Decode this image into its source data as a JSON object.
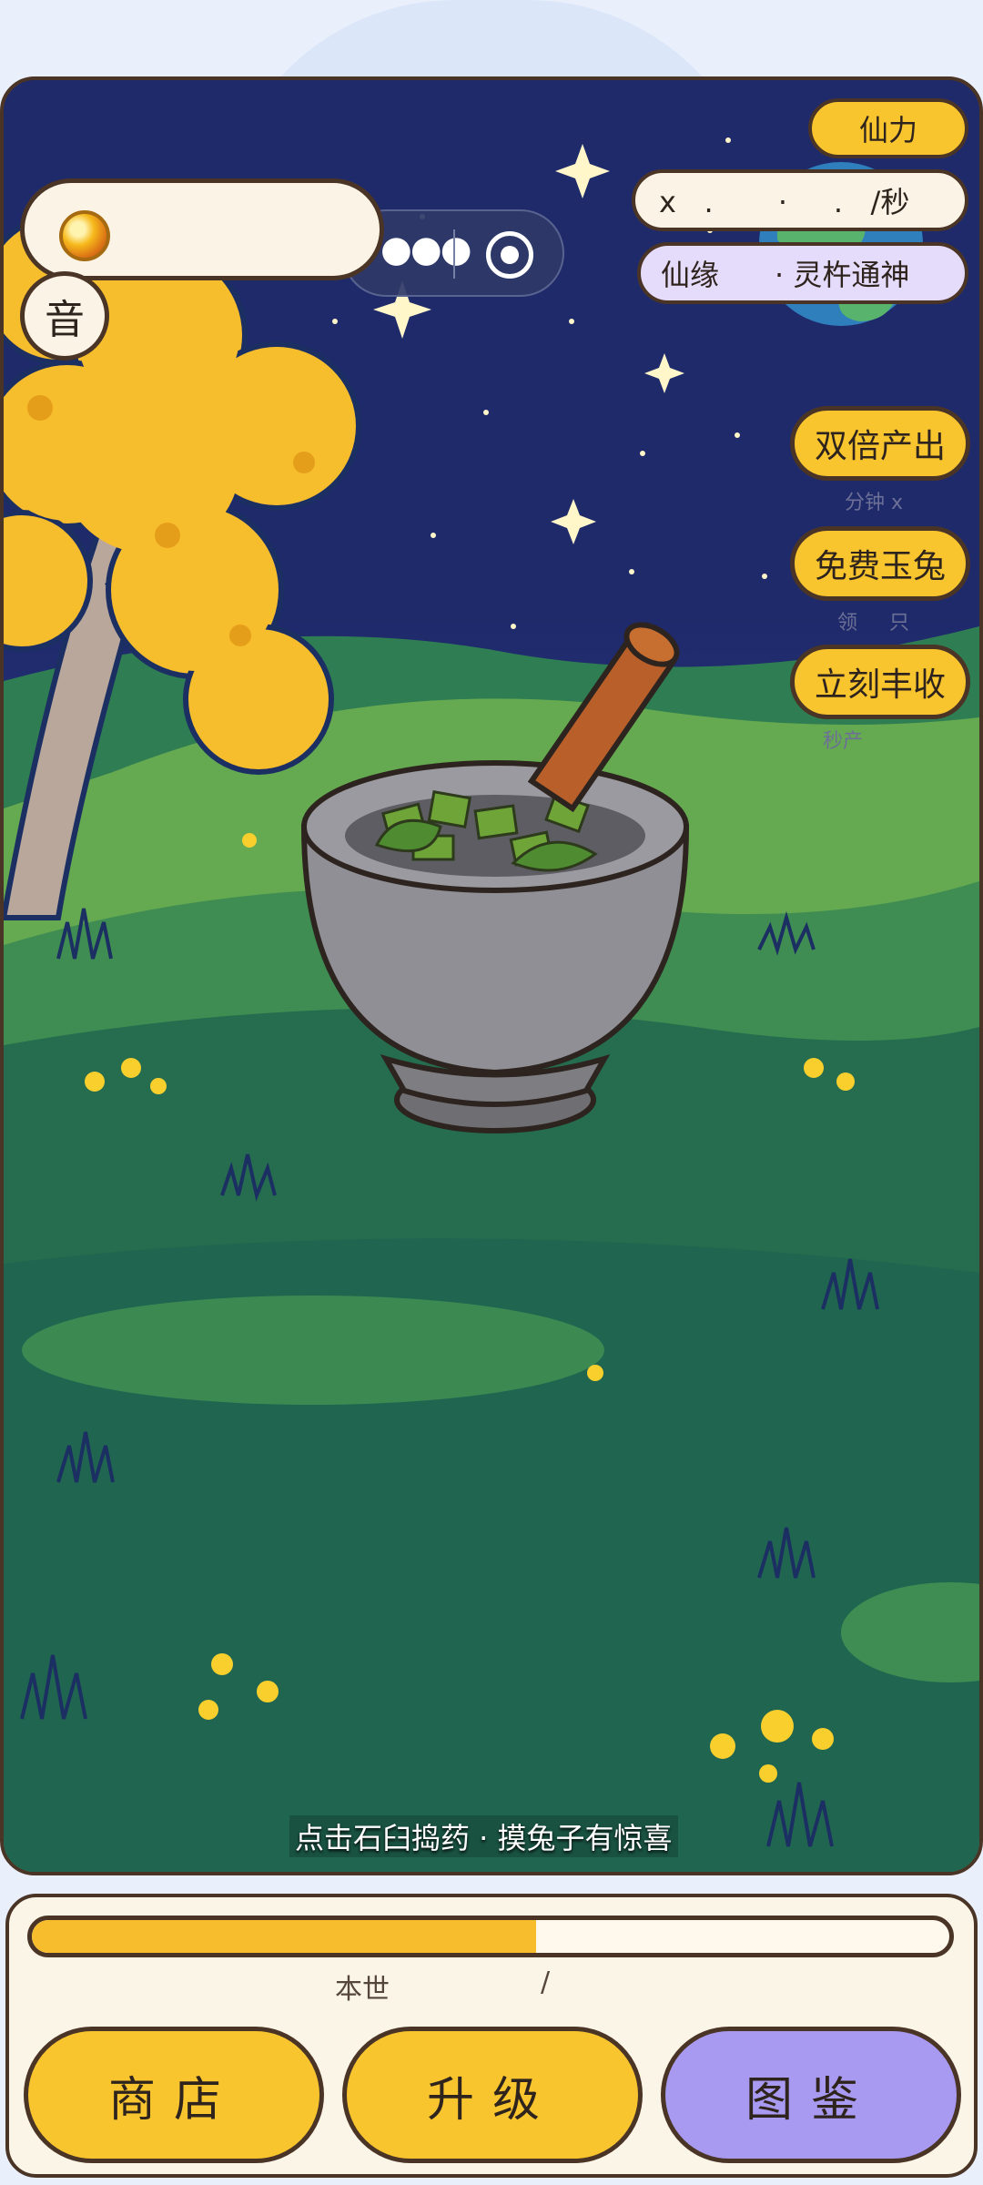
{
  "header": {
    "coin_icon": "gold-coin-icon",
    "sound_label": "音",
    "capsule_more_icon": "more-dots-icon",
    "capsule_close_icon": "target-ring-icon"
  },
  "stats": {
    "power_label": "仙力",
    "rate_text": "x   .       ·     .   /秒",
    "fate_text": "仙缘      · 灵杵通神"
  },
  "side_buttons": [
    {
      "label": "双倍产出",
      "sub": "分钟 x"
    },
    {
      "label": "免费玉兔",
      "sub": "领     只"
    },
    {
      "label": "立刻丰收",
      "sub": "秒产"
    }
  ],
  "hint_text": "点击石臼捣药 · 摸兔子有惊喜",
  "progress": {
    "label_left": "本世",
    "label_sep": "/",
    "fill_fraction": 0.55
  },
  "bottom_nav": [
    {
      "label": "商店"
    },
    {
      "label": "升级"
    },
    {
      "label": "图鉴"
    }
  ],
  "colors": {
    "sky": "#1f2a6b",
    "accent_yellow": "#f8c52e",
    "accent_purple": "#a79af0",
    "outline": "#4a3426",
    "cream": "#fbf4e6"
  }
}
